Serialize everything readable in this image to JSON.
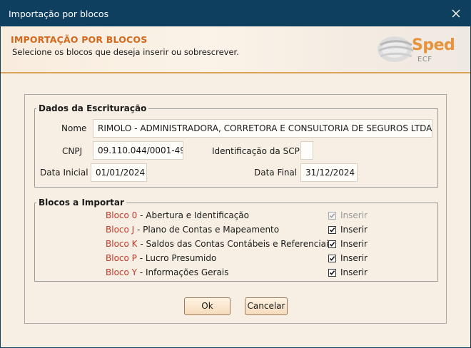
{
  "window": {
    "title": "Importação por blocos"
  },
  "header": {
    "title": "IMPORTAÇÃO POR BLOCOS",
    "subtitle": "Selecione os blocos que deseja inserir ou sobrescrever.",
    "logo": {
      "name": "Sped",
      "sub": "ECF"
    }
  },
  "escrituracao": {
    "legend": "Dados da Escrituração",
    "nome_label": "Nome",
    "nome_value": "RIMOLO - ADMINISTRADORA, CORRETORA E CONSULTORIA DE SEGUROS LTDA",
    "cnpj_label": "CNPJ",
    "cnpj_value": "09.110.044/0001-49",
    "scp_label": "Identificação da SCP",
    "scp_value": "",
    "data_inicial_label": "Data Inicial",
    "data_inicial_value": "01/01/2024",
    "data_final_label": "Data Final",
    "data_final_value": "31/12/2024"
  },
  "blocos": {
    "legend": "Blocos a Importar",
    "items": [
      {
        "bloco": "Bloco 0",
        "desc": " - Abertura e Identificação",
        "insert_label": "Inserir",
        "checked": true,
        "disabled": true
      },
      {
        "bloco": "Bloco J",
        "desc": " - Plano de Contas e Mapeamento",
        "insert_label": "Inserir",
        "checked": true,
        "disabled": false
      },
      {
        "bloco": "Bloco K",
        "desc": " - Saldos das Contas Contábeis e Referenciais",
        "insert_label": "Inserir",
        "checked": true,
        "disabled": false
      },
      {
        "bloco": "Bloco P",
        "desc": " - Lucro Presumido",
        "insert_label": "Inserir",
        "checked": true,
        "disabled": false
      },
      {
        "bloco": "Bloco Y",
        "desc": " - Informações Gerais",
        "insert_label": "Inserir",
        "checked": true,
        "disabled": false
      }
    ]
  },
  "buttons": {
    "ok": "Ok",
    "cancel": "Cancelar"
  },
  "colors": {
    "titlebar": "#0f3f5e",
    "accent": "#d2691e",
    "bloco": "#c0392b"
  }
}
